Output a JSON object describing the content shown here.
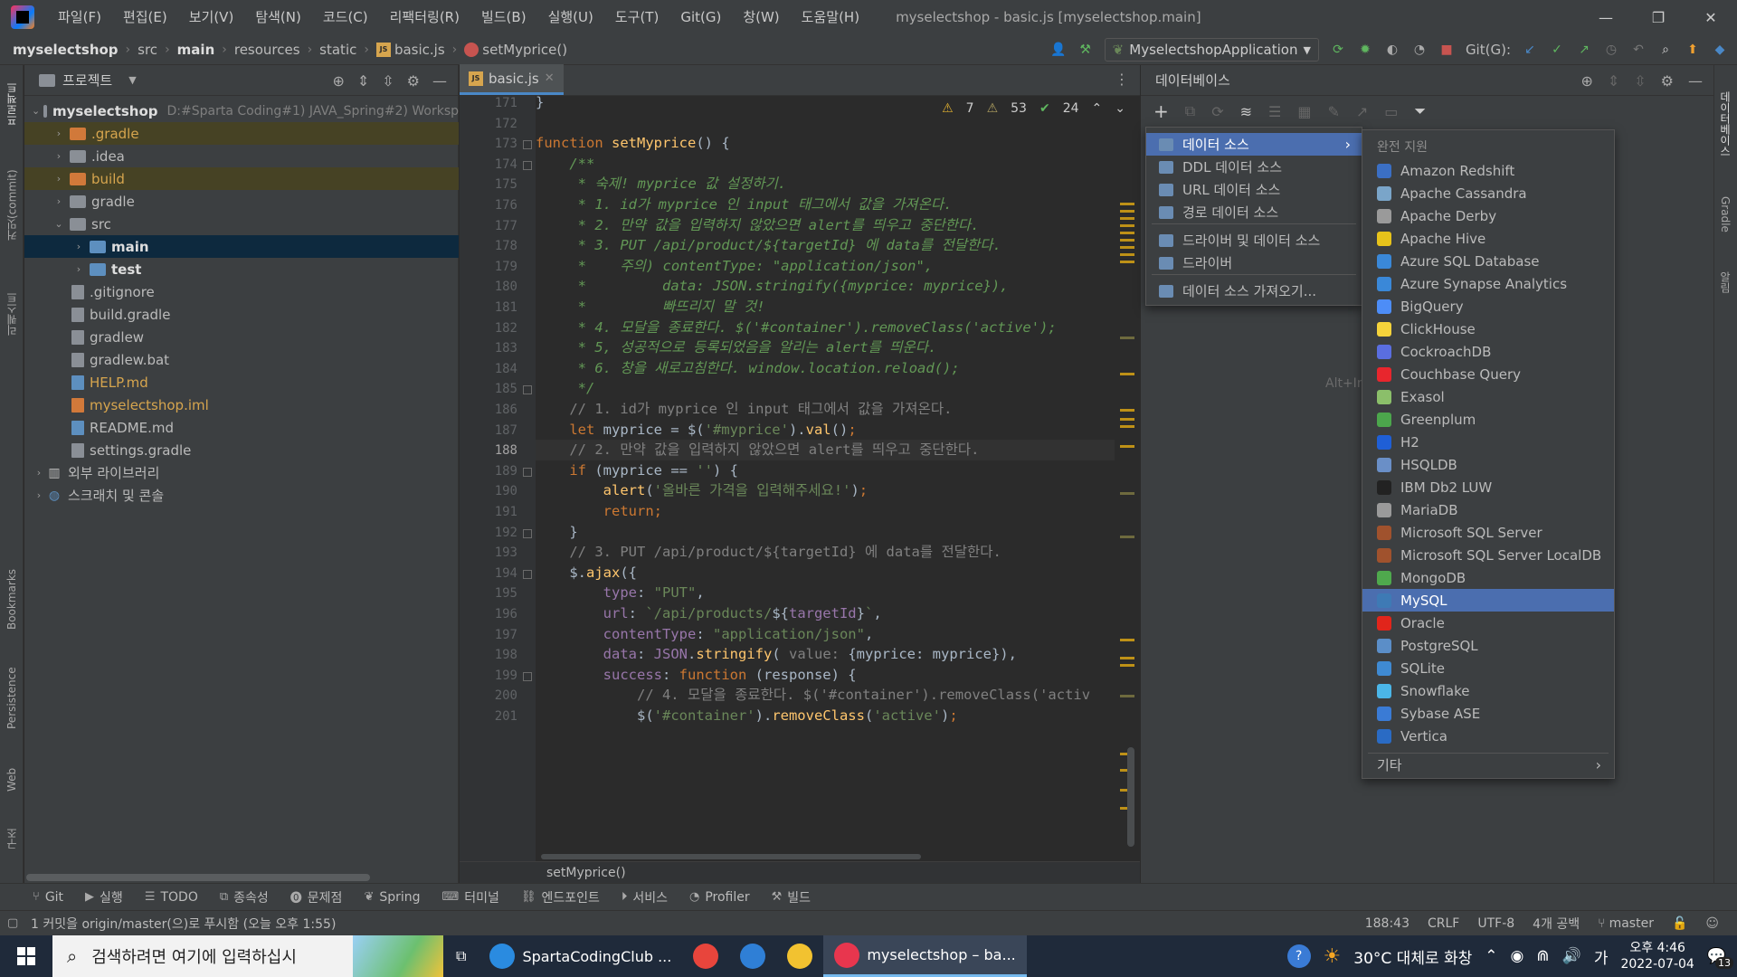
{
  "window": {
    "title": "myselectshop - basic.js [myselectshop.main]",
    "menu": [
      "파일(F)",
      "편집(E)",
      "보기(V)",
      "탐색(N)",
      "코드(C)",
      "리팩터링(R)",
      "빌드(B)",
      "실행(U)",
      "도구(T)",
      "Git(G)",
      "창(W)",
      "도움말(H)"
    ],
    "controls": [
      "—",
      "❐",
      "✕"
    ]
  },
  "nav": {
    "crumbs": [
      "myselectshop",
      "src",
      "main",
      "resources",
      "static",
      "basic.js",
      "setMyprice()"
    ],
    "run_config": "MyselectshopApplication",
    "git_label": "Git(G):"
  },
  "left_strip": [
    "프로젝트",
    "커밋(commit)",
    "리퀘스트",
    "Bookmarks",
    "Persistence",
    "Web",
    "구조"
  ],
  "right_strip": [
    "데이터베이스",
    "Gradle",
    "알림"
  ],
  "project": {
    "title": "프로젝트",
    "root_name": "myselectshop",
    "root_path": "D:#Sparta Coding#1) JAVA_Spring#2) Worksp",
    "items": [
      {
        "name": ".gradle",
        "kind": "folder-orange",
        "level": 1,
        "expand": "›",
        "style": "hl"
      },
      {
        "name": ".idea",
        "kind": "folder",
        "level": 1,
        "expand": "›",
        "style": ""
      },
      {
        "name": "build",
        "kind": "folder-orange",
        "level": 1,
        "expand": "›",
        "style": "hl"
      },
      {
        "name": "gradle",
        "kind": "folder",
        "level": 1,
        "expand": "›",
        "style": ""
      },
      {
        "name": "src",
        "kind": "folder",
        "level": 1,
        "expand": "⌄",
        "style": ""
      },
      {
        "name": "main",
        "kind": "folder-blue",
        "level": 2,
        "expand": "›",
        "style": "sel"
      },
      {
        "name": "test",
        "kind": "folder-blue",
        "level": 2,
        "expand": "›",
        "style": ""
      },
      {
        "name": ".gitignore",
        "kind": "file",
        "level": 1,
        "expand": "",
        "style": ""
      },
      {
        "name": "build.gradle",
        "kind": "file",
        "level": 1,
        "expand": "",
        "style": ""
      },
      {
        "name": "gradlew",
        "kind": "file",
        "level": 1,
        "expand": "",
        "style": ""
      },
      {
        "name": "gradlew.bat",
        "kind": "file",
        "level": 1,
        "expand": "",
        "style": ""
      },
      {
        "name": "HELP.md",
        "kind": "file-md",
        "level": 1,
        "expand": "",
        "style": "orange"
      },
      {
        "name": "myselectshop.iml",
        "kind": "file-iml",
        "level": 1,
        "expand": "",
        "style": "orange"
      },
      {
        "name": "README.md",
        "kind": "file-md",
        "level": 1,
        "expand": "",
        "style": ""
      },
      {
        "name": "settings.gradle",
        "kind": "file",
        "level": 1,
        "expand": "",
        "style": ""
      },
      {
        "name": "외부 라이브러리",
        "kind": "lib",
        "level": 0,
        "expand": "›",
        "style": ""
      },
      {
        "name": "스크래치 및 콘솔",
        "kind": "scratch",
        "level": 0,
        "expand": "›",
        "style": ""
      }
    ]
  },
  "editor": {
    "tab": "basic.js",
    "inspections": {
      "warnings": "7",
      "weak": "53",
      "ok": "24"
    },
    "current_line": 188,
    "lines": [
      {
        "n": 171,
        "html": "<span>}</span>"
      },
      {
        "n": 172,
        "html": ""
      },
      {
        "n": 173,
        "html": "<span class=\"kw\">function </span><span class=\"fn\">setMyprice</span>() {"
      },
      {
        "n": 174,
        "html": "    <span class=\"doc\">/**</span>"
      },
      {
        "n": 175,
        "html": "     <span class=\"doc\">* 숙제! myprice 값 설정하기.</span>"
      },
      {
        "n": 176,
        "html": "     <span class=\"doc\">* 1. id가 myprice 인 input 태그에서 값을 가져온다.</span>"
      },
      {
        "n": 177,
        "html": "     <span class=\"doc\">* 2. 만약 값을 입력하지 않았으면 alert를 띄우고 중단한다.</span>"
      },
      {
        "n": 178,
        "html": "     <span class=\"doc\">* 3. PUT /api/product/${targetId} 에 data를 전달한다.</span>"
      },
      {
        "n": 179,
        "html": "     <span class=\"doc\">*    주의) contentType: \"application/json\",</span>"
      },
      {
        "n": 180,
        "html": "     <span class=\"doc\">*         data: JSON.stringify({myprice: myprice}),</span>"
      },
      {
        "n": 181,
        "html": "     <span class=\"doc\">*         빠뜨리지 말 것!</span>"
      },
      {
        "n": 182,
        "html": "     <span class=\"doc\">* 4. 모달을 종료한다. $('#container').removeClass('active');</span>"
      },
      {
        "n": 183,
        "html": "     <span class=\"doc\">* 5, 성공적으로 등록되었음을 알리는 alert를 띄운다.</span>"
      },
      {
        "n": 184,
        "html": "     <span class=\"doc\">* 6. 창을 새로고침한다. window.location.reload();</span>"
      },
      {
        "n": 185,
        "html": "     <span class=\"doc\">*/</span>"
      },
      {
        "n": 186,
        "html": "    <span class=\"cmt\">// 1. id가 myprice 인 input 태그에서 값을 가져온다.</span>"
      },
      {
        "n": 187,
        "html": "    <span class=\"kw\">let </span>myprice = $(<span class=\"str\">'#myprice'</span>).<span class=\"fn\">val</span>()<span class=\"kw\">;</span>"
      },
      {
        "n": 188,
        "html": "    <span class=\"cmt\">// 2. 만약 값을 입력하지 않았으면 alert를 띄우고 중단한다.</span>"
      },
      {
        "n": 189,
        "html": "    <span class=\"kw\">if </span>(myprice == <span class=\"str\">''</span>) {"
      },
      {
        "n": 190,
        "html": "        <span class=\"fn\">alert</span>(<span class=\"str\">'올바른 가격을 입력해주세요!'</span>)<span class=\"kw\">;</span>"
      },
      {
        "n": 191,
        "html": "        <span class=\"kw\">return;</span>"
      },
      {
        "n": 192,
        "html": "    }"
      },
      {
        "n": 193,
        "html": "    <span class=\"cmt\">// 3. PUT /api/product/${targetId} 에 data를 전달한다.</span>"
      },
      {
        "n": 194,
        "html": "    $.<span class=\"fn\">ajax</span>({"
      },
      {
        "n": 195,
        "html": "        <span class=\"prop\">type</span>: <span class=\"str\">\"PUT\"</span>,"
      },
      {
        "n": 196,
        "html": "        <span class=\"prop\">url</span>: <span class=\"str\">`/api/products/</span>${<span class=\"prop\">targetId</span>}<span class=\"str\">`</span>,"
      },
      {
        "n": 197,
        "html": "        <span class=\"prop\">contentType</span>: <span class=\"str\">\"application/json\"</span>,"
      },
      {
        "n": 198,
        "html": "        <span class=\"prop\">data</span>: <span class=\"prop\">JSON</span>.<span class=\"fn\">stringify</span>( <span class=\"cmt\">value:</span> {myprice: myprice}),"
      },
      {
        "n": 199,
        "html": "        <span class=\"prop\">success</span>: <span class=\"kw\">function </span>(response) {"
      },
      {
        "n": 200,
        "html": "            <span class=\"cmt\">// 4. 모달을 종료한다. $('#container').removeClass('activ</span>"
      },
      {
        "n": 201,
        "html": "            $(<span class=\"str\">'#container'</span>).<span class=\"fn\">removeClass</span>(<span class=\"str\">'active'</span>)<span class=\"kw\">;</span>"
      }
    ],
    "bottom_crumb": "setMyprice()"
  },
  "database": {
    "title": "데이터베이스",
    "alt_hint": "Alt+In",
    "menu": [
      {
        "label": "데이터 소스",
        "active": true,
        "arrow": "›"
      },
      {
        "label": "DDL 데이터 소스",
        "active": false,
        "arrow": ""
      },
      {
        "label": "URL 데이터 소스",
        "active": false,
        "arrow": ""
      },
      {
        "label": "경로 데이터 소스",
        "active": false,
        "arrow": ""
      },
      {
        "label": "드라이버 및 데이터 소스",
        "active": false,
        "arrow": ""
      },
      {
        "label": "드라이버",
        "active": false,
        "arrow": ""
      },
      {
        "label": "데이터 소스 가져오기...",
        "active": false,
        "arrow": ""
      }
    ],
    "submenu_title": "완전 지원",
    "sources": [
      {
        "name": "Amazon Redshift",
        "color": "#3b6fc4"
      },
      {
        "name": "Apache Cassandra",
        "color": "#7aa5c9"
      },
      {
        "name": "Apache Derby",
        "color": "#9a9a9a"
      },
      {
        "name": "Apache Hive",
        "color": "#e7c31b"
      },
      {
        "name": "Azure SQL Database",
        "color": "#3a88d8"
      },
      {
        "name": "Azure Synapse Analytics",
        "color": "#3a88d8"
      },
      {
        "name": "BigQuery",
        "color": "#4d8df7"
      },
      {
        "name": "ClickHouse",
        "color": "#f5d33b"
      },
      {
        "name": "CockroachDB",
        "color": "#5a6ee0"
      },
      {
        "name": "Couchbase Query",
        "color": "#e8262d"
      },
      {
        "name": "Exasol",
        "color": "#8bbf6a"
      },
      {
        "name": "Greenplum",
        "color": "#4ca64c"
      },
      {
        "name": "H2",
        "color": "#1f5fd6"
      },
      {
        "name": "HSQLDB",
        "color": "#6a8fc7"
      },
      {
        "name": "IBM Db2 LUW",
        "color": "#222222"
      },
      {
        "name": "MariaDB",
        "color": "#9a9a9a"
      },
      {
        "name": "Microsoft SQL Server",
        "color": "#a0522d"
      },
      {
        "name": "Microsoft SQL Server LocalDB",
        "color": "#a0522d"
      },
      {
        "name": "MongoDB",
        "color": "#4fa94d"
      },
      {
        "name": "MySQL",
        "color": "#3e7ab5"
      },
      {
        "name": "Oracle",
        "color": "#e1251b"
      },
      {
        "name": "PostgreSQL",
        "color": "#5b8ec8"
      },
      {
        "name": "SQLite",
        "color": "#3f8ad2"
      },
      {
        "name": "Snowflake",
        "color": "#4bb6e8"
      },
      {
        "name": "Sybase ASE",
        "color": "#3a7bd5"
      },
      {
        "name": "Vertica",
        "color": "#2a6bc4"
      }
    ],
    "selected_source": "MySQL",
    "other": "기타"
  },
  "tool_windows": [
    "Git",
    "실행",
    "TODO",
    "종속성",
    "문제점",
    "Spring",
    "터미널",
    "엔드포인트",
    "서비스",
    "Profiler",
    "빌드"
  ],
  "status": {
    "message": "1 커밋을 origin/master(으)로 푸시함 (오늘 오후 1:55)",
    "position": "188:43",
    "line_sep": "CRLF",
    "encoding": "UTF-8",
    "indent": "4개 공백",
    "branch": "master"
  },
  "taskbar": {
    "search_placeholder": "검색하려면 여기에 입력하십시",
    "apps": [
      {
        "label": "SpartaCodingClub ...",
        "color": "#2a8be0",
        "active": false
      },
      {
        "label": "",
        "color": "#e8453c",
        "active": false
      },
      {
        "label": "",
        "color": "#2f7fd6",
        "active": false
      },
      {
        "label": "",
        "color": "#f2c230",
        "active": false
      },
      {
        "label": "myselectshop – ba...",
        "color": "#e8364e",
        "active": true
      }
    ],
    "weather": "30°C  대체로 화창",
    "ime": "가",
    "time": "오후 4:46",
    "date": "2022-07-04",
    "notifications": "13"
  }
}
